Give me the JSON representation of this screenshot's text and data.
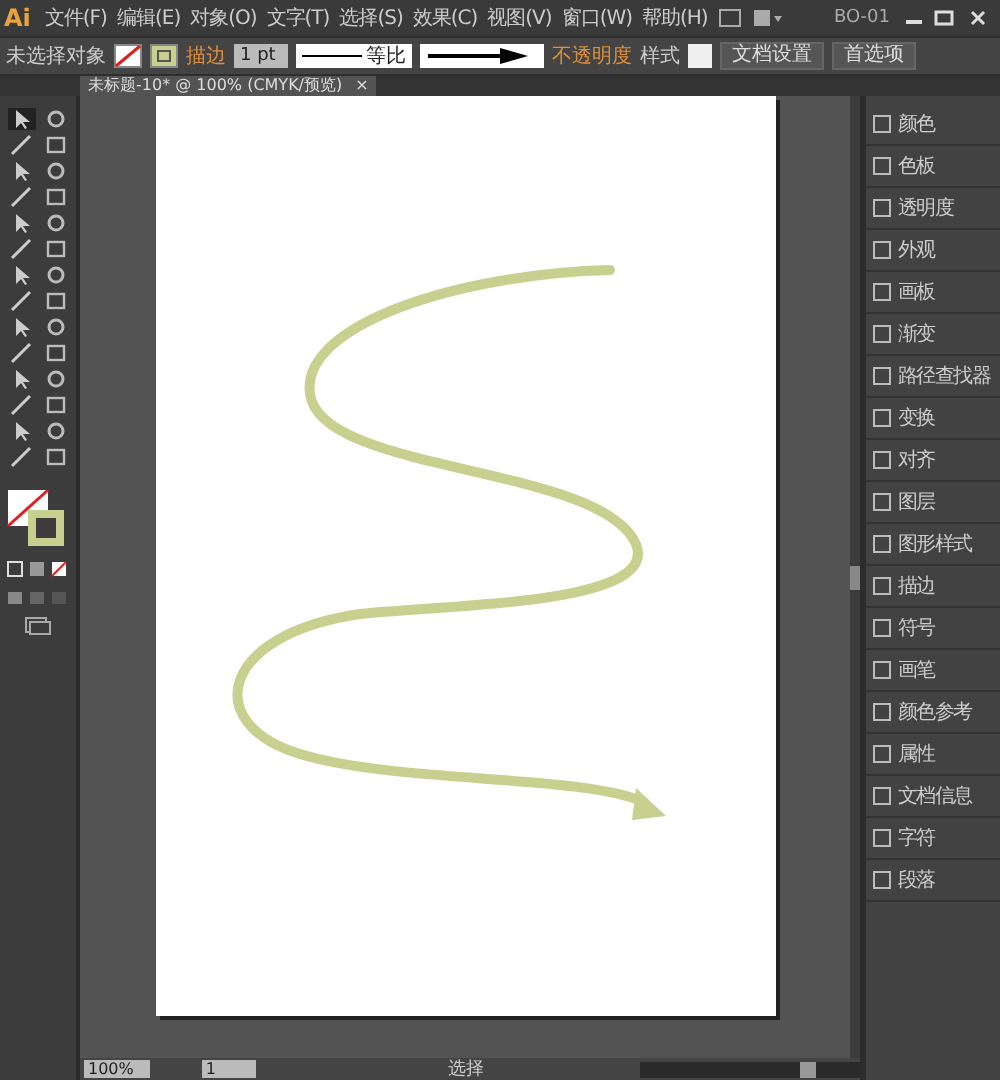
{
  "app": {
    "logo": "Ai",
    "workspace": "BO-01"
  },
  "menu": [
    "文件(F)",
    "编辑(E)",
    "对象(O)",
    "文字(T)",
    "选择(S)",
    "效果(C)",
    "视图(V)",
    "窗口(W)",
    "帮助(H)"
  ],
  "control_bar": {
    "selection": "未选择对象",
    "stroke_label": "描边",
    "stroke_weight": "1 pt",
    "profile": "等比",
    "opacity_label": "不透明度",
    "style_label": "样式",
    "buttons": [
      "文档设置",
      "首选项"
    ]
  },
  "tabs": [
    {
      "label": "未标题-10* @ 100% (CMYK/预览)",
      "close": "×",
      "selected": true
    }
  ],
  "panels": [
    "颜色",
    "色板",
    "透明度",
    "外观",
    "画板",
    "渐变",
    "路径查找器",
    "变换",
    "对齐",
    "图层",
    "图形样式",
    "描边",
    "符号",
    "画笔",
    "颜色参考",
    "属性",
    "文档信息",
    "字符",
    "段落"
  ],
  "status_bar": {
    "zoom": "100%",
    "artboard": "1",
    "tool": "选择"
  }
}
